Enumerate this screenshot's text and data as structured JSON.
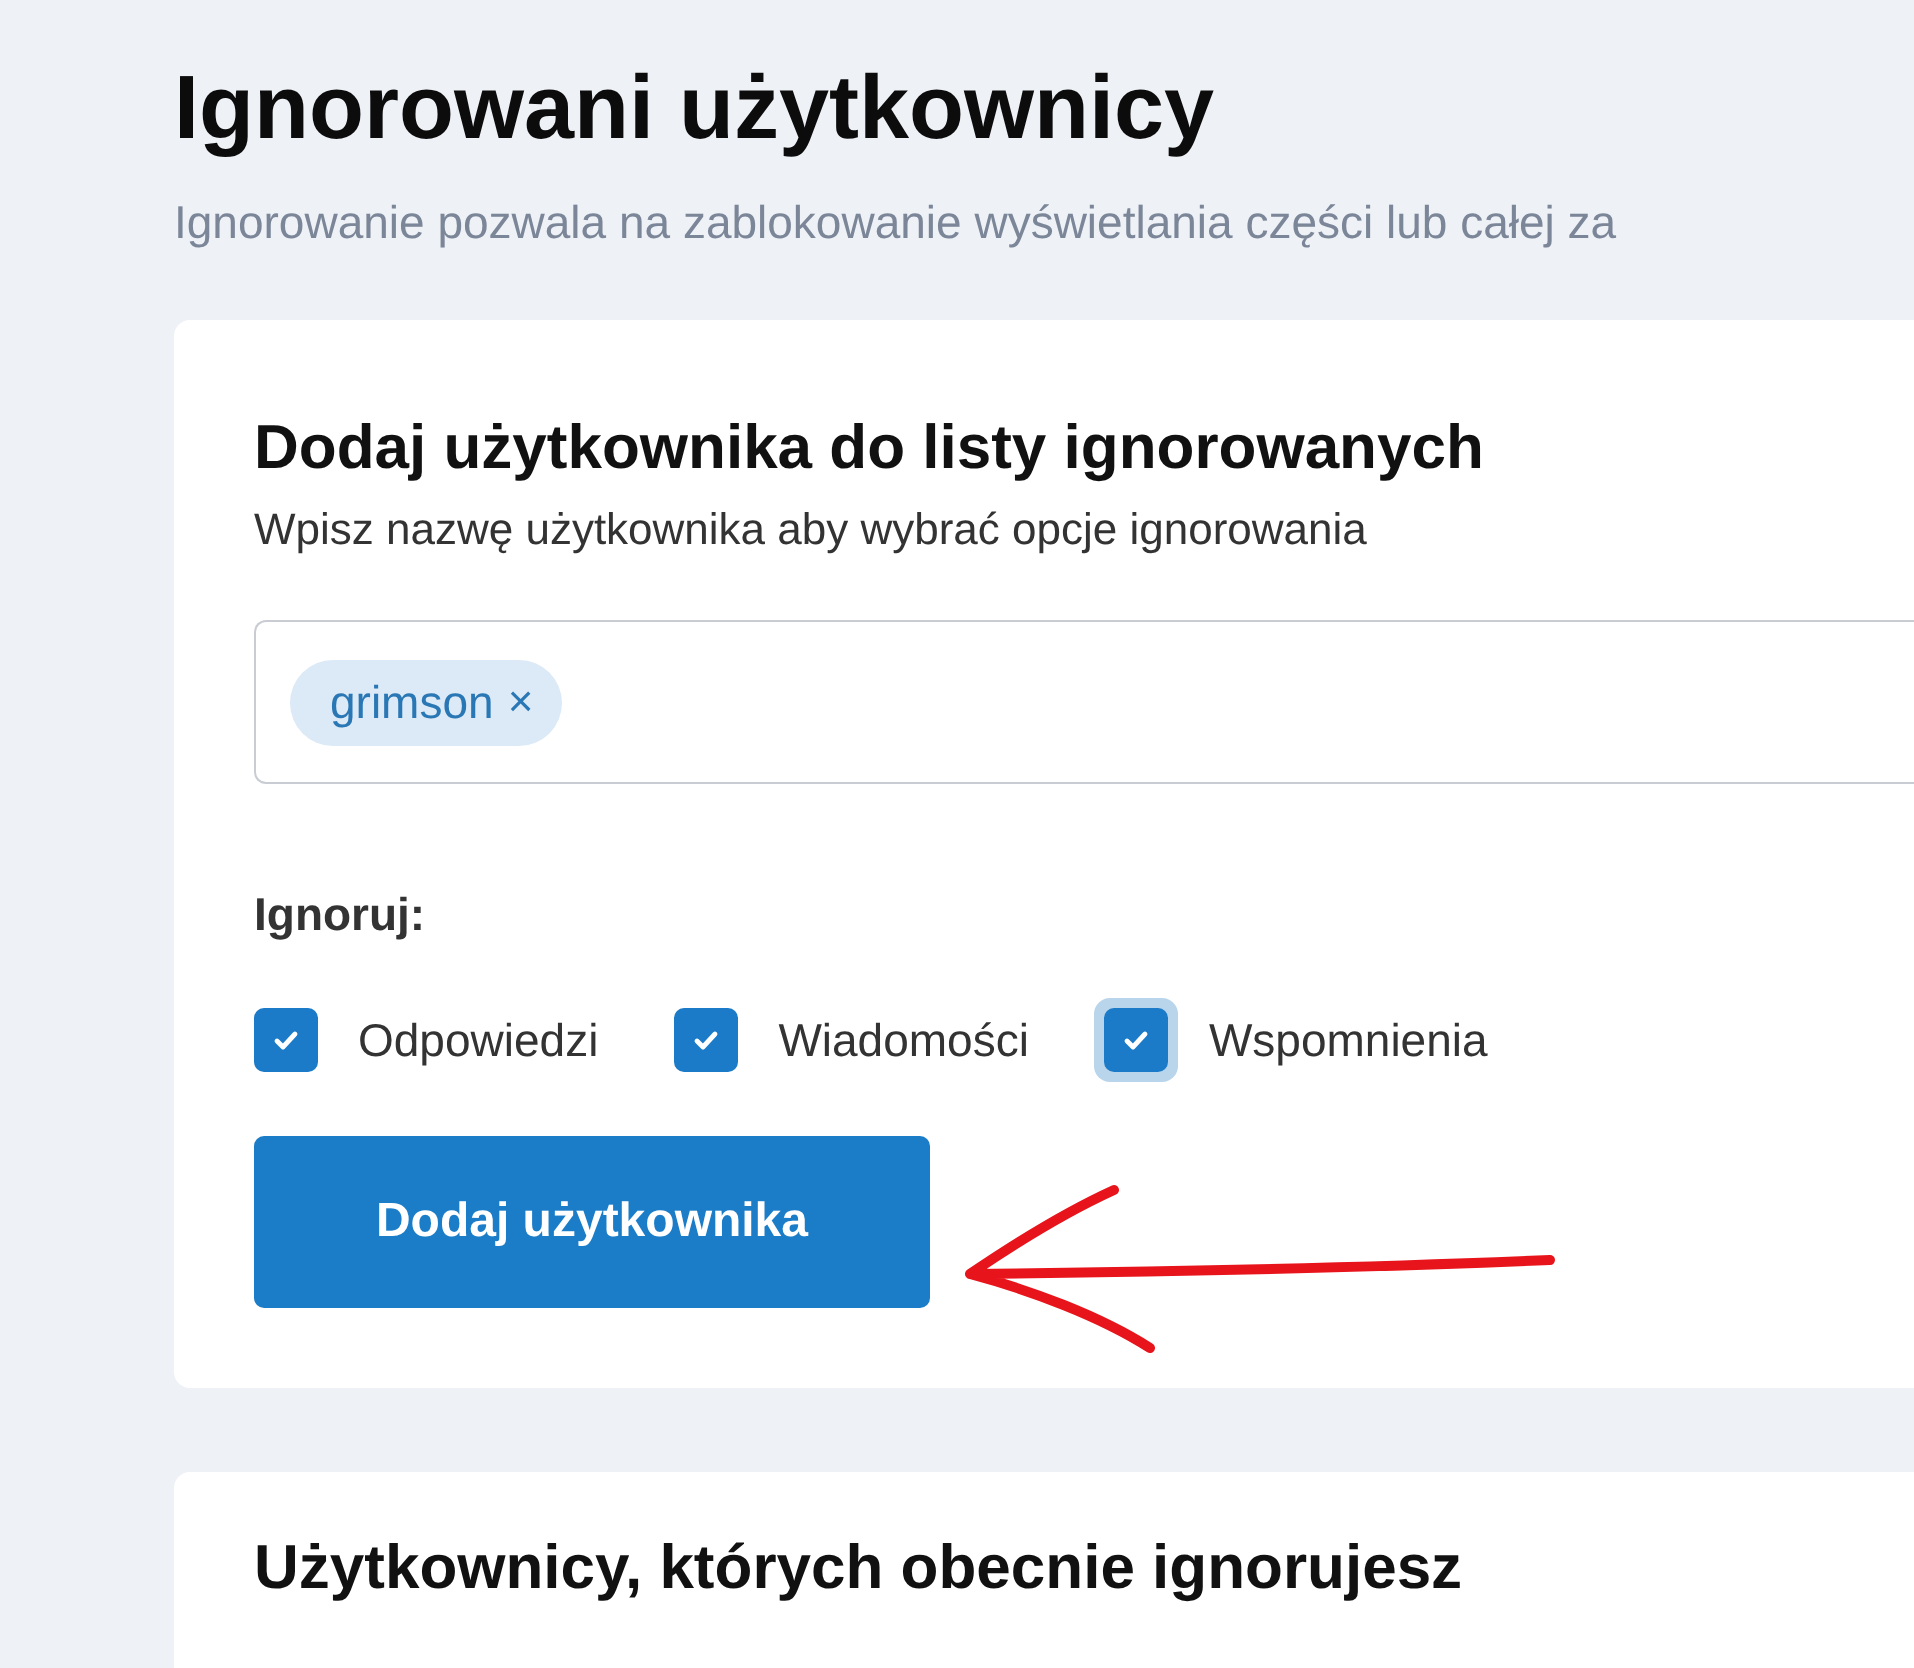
{
  "page": {
    "title": "Ignorowani użytkownicy",
    "subtitle": "Ignorowanie pozwala na zablokowanie wyświetlania części lub całej za"
  },
  "add_card": {
    "title": "Dodaj użytkownika do listy ignorowanych",
    "description": "Wpisz nazwę użytkownika aby wybrać opcje ignorowania",
    "field": {
      "chips": [
        {
          "label": "grimson",
          "remove": "×"
        }
      ]
    },
    "options_label": "Ignoruj:",
    "options": [
      {
        "label": "Odpowiedzi",
        "checked": true,
        "focused": false
      },
      {
        "label": "Wiadomości",
        "checked": true,
        "focused": false
      },
      {
        "label": "Wspomnienia",
        "checked": true,
        "focused": true
      }
    ],
    "button": "Dodaj użytkownika"
  },
  "list_card": {
    "title": "Użytkownicy, których obecnie ignorujesz"
  },
  "annotations": [
    {
      "kind": "arrow"
    }
  ]
}
